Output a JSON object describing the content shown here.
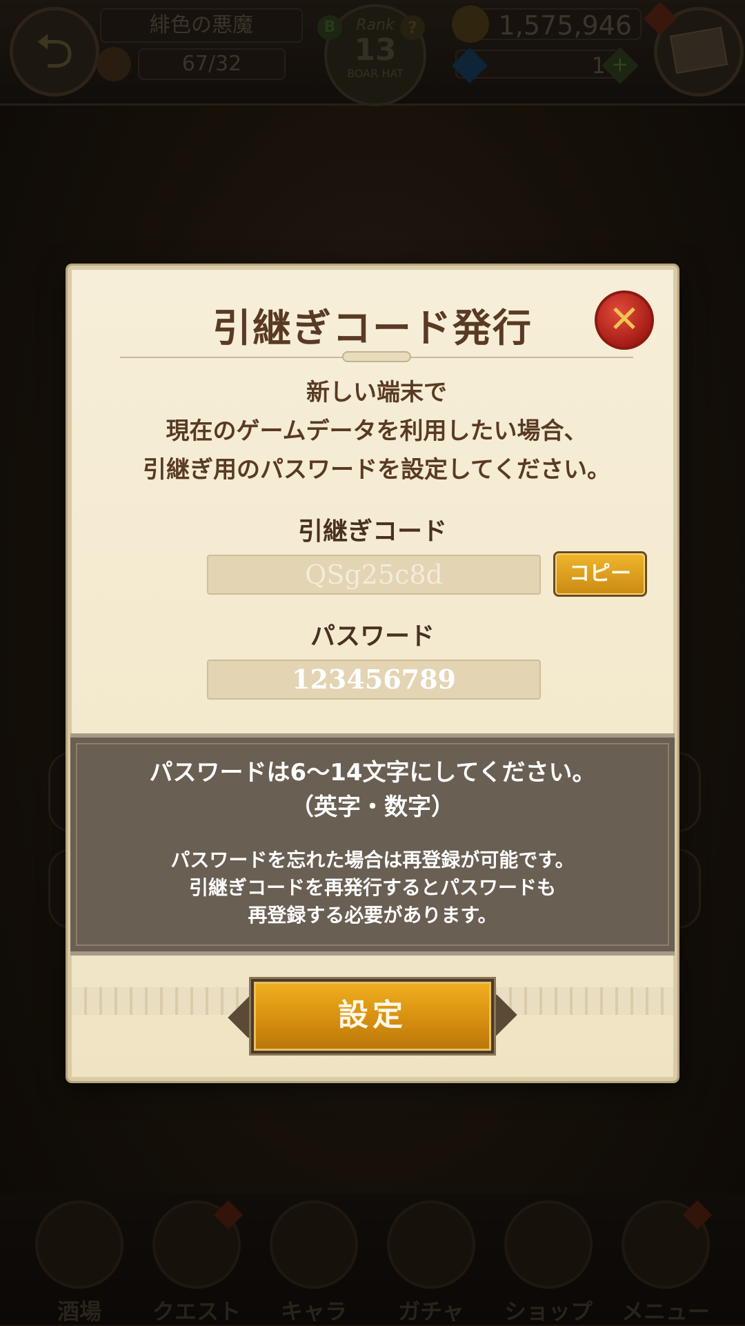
{
  "hud": {
    "stage_name": "緋色の悪魔",
    "stamina": "67/32",
    "rank_label": "Rank",
    "rank_value": "13",
    "rank_title": "BOAR HAT",
    "rank_badge": "B",
    "help_glyph": "?",
    "gold": "1,575,946",
    "gems": "1",
    "gem_add_glyph": "+",
    "back_icon": "arrow-back-icon",
    "mail_icon": "envelope-icon"
  },
  "modal": {
    "title": "引継ぎコード発行",
    "close_glyph": "✕",
    "description_lines": [
      "新しい端末で",
      "現在のゲームデータを利用したい場合、",
      "引継ぎ用のパスワードを設定してください。"
    ],
    "code_label": "引継ぎコード",
    "code_value": "QSg25c8d",
    "copy_label": "コピー",
    "password_label": "パスワード",
    "password_value": "123456789",
    "info_main_lines": [
      "パスワードは6〜14文字にしてください。",
      "（英字・数字）"
    ],
    "info_note_lines": [
      "パスワードを忘れた場合は再登録が可能です。",
      "引継ぎコードを再発行するとパスワードも",
      "再登録する必要があります。"
    ],
    "submit_label": "設定"
  },
  "nav": {
    "items": [
      {
        "label": "酒場",
        "icon": "tavern-icon",
        "alert": false
      },
      {
        "label": "クエスト",
        "icon": "quest-scroll-icon",
        "alert": true
      },
      {
        "label": "キャラ",
        "icon": "knight-helmet-icon",
        "alert": false
      },
      {
        "label": "ガチャ",
        "icon": "crystal-icon",
        "alert": false
      },
      {
        "label": "ショップ",
        "icon": "shop-sign-icon",
        "alert": false
      },
      {
        "label": "メニュー",
        "icon": "gear-icon",
        "alert": true
      }
    ]
  },
  "colors": {
    "parchment": "#f5ecd4",
    "title_brown": "#5a3a24",
    "gold_button": "#e0a21c",
    "close_red": "#c0281d",
    "info_panel": "#6a5f53"
  }
}
